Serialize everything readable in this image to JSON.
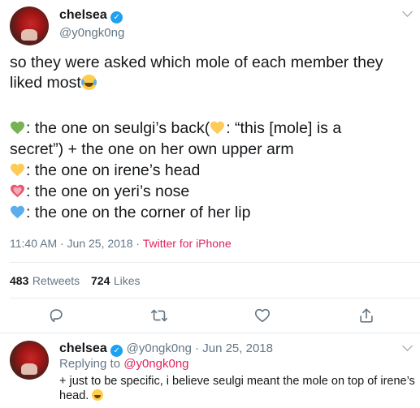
{
  "colors": {
    "accent": "#e0245e",
    "verified": "#1da1f2",
    "muted": "#657786",
    "divider": "#e6ecf0"
  },
  "tweet": {
    "display_name": "chelsea",
    "handle": "@y0ngk0ng",
    "text_line1": "so they were asked which mole of each member they",
    "text_line2": "liked most",
    "lines": [
      ": the one on seulgi’s back(",
      ": “this [mole] is a",
      "secret”) + the one on her own upper arm",
      ": the one on irene’s head",
      ": the one on yeri’s nose",
      ": the one on the corner of her lip"
    ],
    "time": "11:40 AM · Jun 25, 2018",
    "separator": "·",
    "source": "Twitter for iPhone",
    "retweets_count": "483",
    "retweets_label": "Retweets",
    "likes_count": "724",
    "likes_label": "Likes"
  },
  "reply": {
    "display_name": "chelsea",
    "handle_date": "@y0ngk0ng · Jun 25, 2018",
    "replying_prefix": "Replying to",
    "replying_handle": "@y0ngk0ng",
    "text_line1": "+ just to be specific, i believe seulgi meant the mole on top of irene’s",
    "text_line2": "head."
  },
  "icons": [
    "verified-badge-icon",
    "chevron-down-icon",
    "green-heart-icon",
    "yellow-heart-icon",
    "sparkling-heart-icon",
    "blue-heart-icon",
    "laughing-tears-emoji-icon",
    "grinning-sweat-emoji-icon",
    "reply-icon",
    "retweet-icon",
    "like-icon",
    "share-icon"
  ]
}
